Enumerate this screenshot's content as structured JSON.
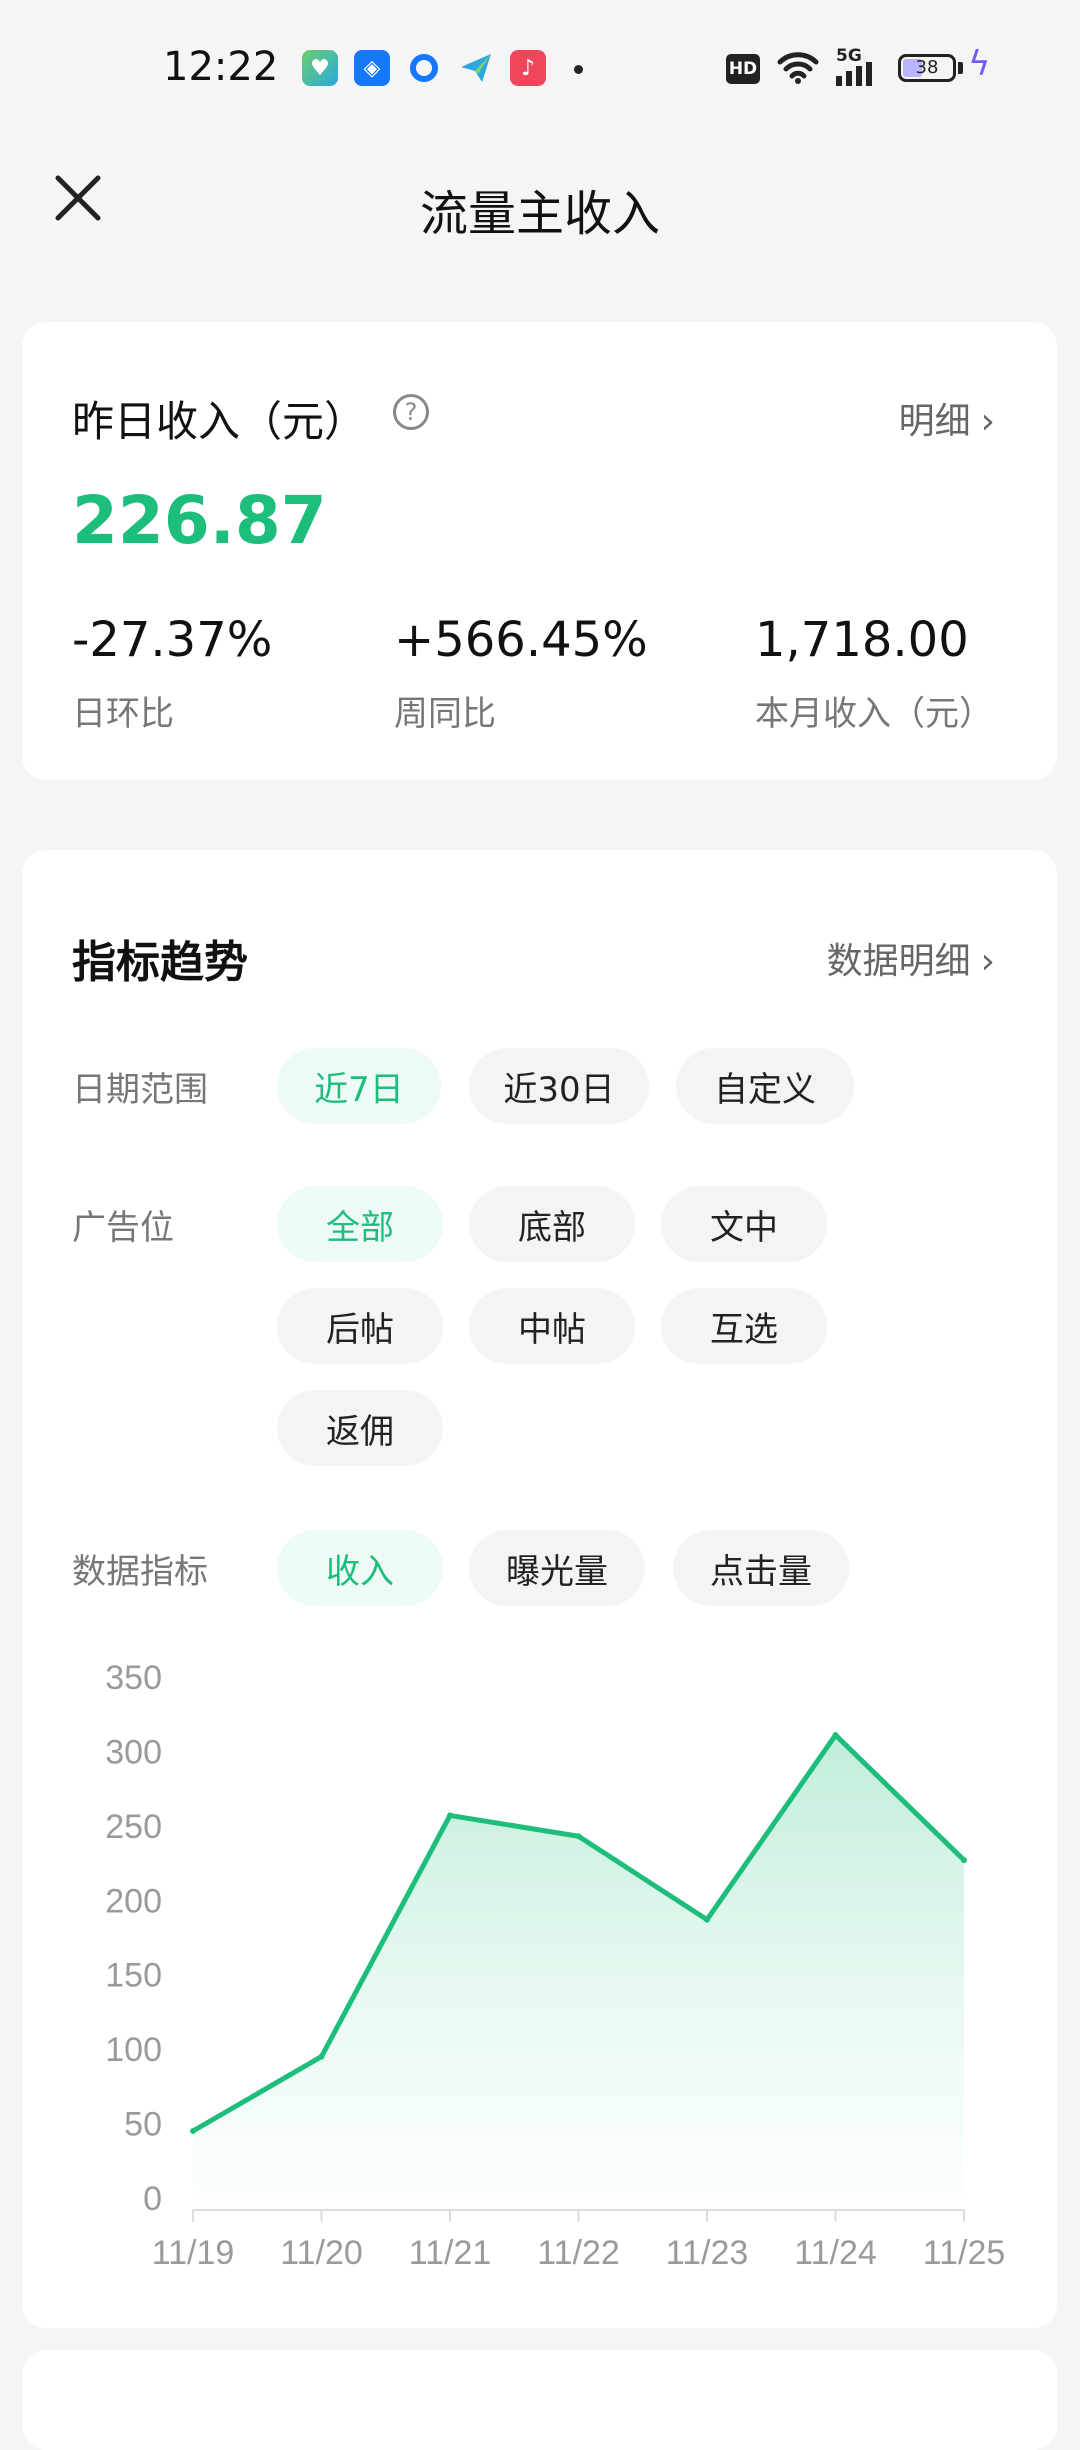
{
  "status_bar": {
    "time": "12:22",
    "icons": [
      "health-app-icon",
      "shield-app-icon",
      "browser-app-icon",
      "send-app-icon",
      "music-app-icon"
    ],
    "hd_label": "HD",
    "network": "5G",
    "battery_level": "38"
  },
  "header": {
    "title": "流量主收入"
  },
  "income_card": {
    "label": "昨日收入（元）",
    "help_glyph": "?",
    "detail_link": "明细",
    "amount": "226.87",
    "stats": [
      {
        "value": "-27.37%",
        "label": "日环比"
      },
      {
        "value": "+566.45%",
        "label": "周同比"
      },
      {
        "value": "1,718.00",
        "label": "本月收入（元）"
      }
    ]
  },
  "trend_card": {
    "title": "指标趋势",
    "data_link": "数据明细",
    "date_range": {
      "label": "日期范围",
      "options": [
        "近7日",
        "近30日",
        "自定义"
      ],
      "selected": "近7日"
    },
    "ad_position": {
      "label": "广告位",
      "options": [
        "全部",
        "底部",
        "文中",
        "后帖",
        "中帖",
        "互选",
        "返佣"
      ],
      "selected": "全部"
    },
    "metric": {
      "label": "数据指标",
      "options": [
        "收入",
        "曝光量",
        "点击量"
      ],
      "selected": "收入"
    }
  },
  "colors": {
    "accent": "#1dbe7c",
    "chip_active_bg": "#eefaf5",
    "chip_bg": "#f4f4f4",
    "page_bg": "#f5f5f5"
  },
  "chart_data": {
    "type": "area",
    "x": [
      "11/19",
      "11/20",
      "11/21",
      "11/22",
      "11/23",
      "11/24",
      "11/25"
    ],
    "series": [
      {
        "values": [
          45,
          95,
          257,
          243,
          187,
          311,
          227
        ]
      }
    ],
    "y_ticks": [
      0,
      50,
      100,
      150,
      200,
      250,
      300,
      350
    ],
    "ylim": [
      0,
      350
    ],
    "grid": false,
    "color": "#1dbe7c"
  }
}
